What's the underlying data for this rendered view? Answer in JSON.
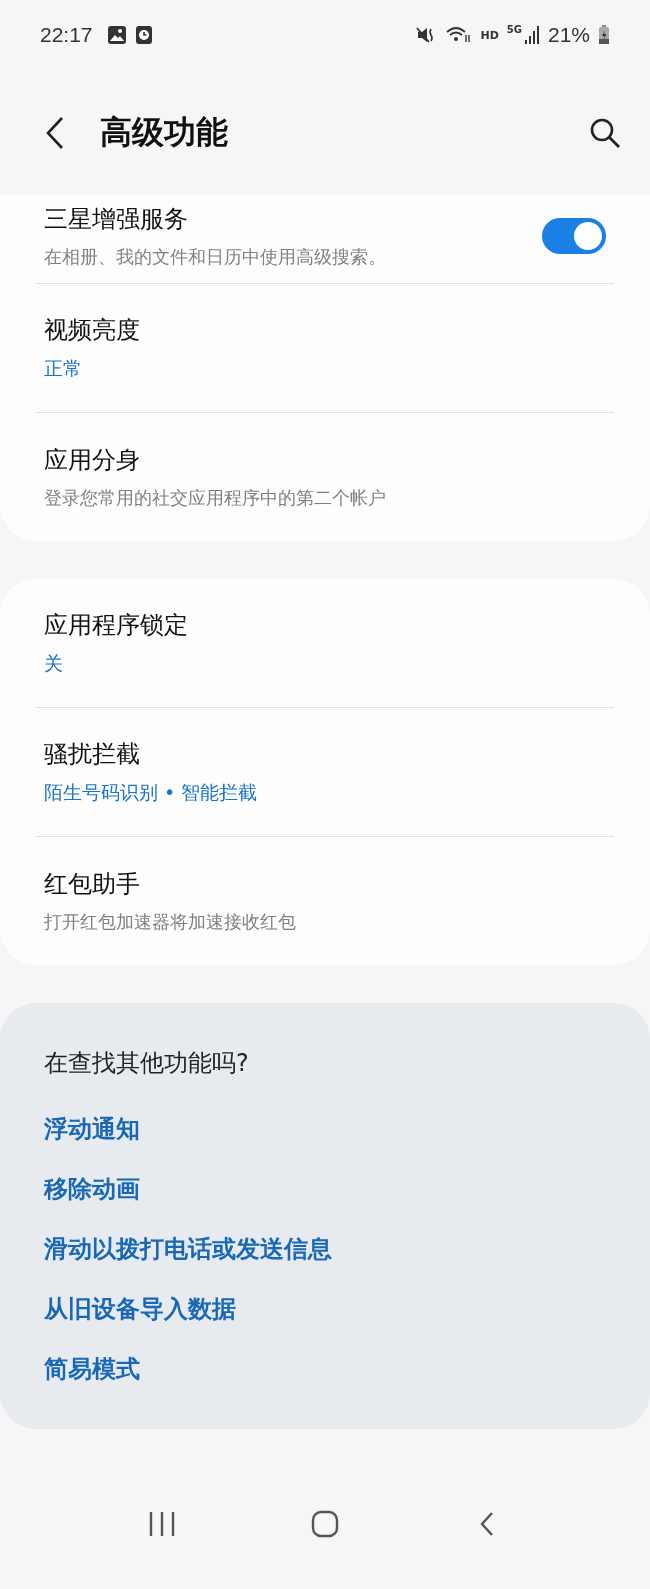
{
  "status_bar": {
    "time": "22:17",
    "network": "HD",
    "generation": "5G",
    "battery": "21%"
  },
  "header": {
    "title": "高级功能"
  },
  "groups": [
    {
      "items": [
        {
          "kind": "toggle",
          "title": "三星增强服务",
          "subtitle": "在相册、我的文件和日历中使用高级搜索。",
          "on": true
        },
        {
          "kind": "value",
          "title": "视频亮度",
          "subtitle": "正常"
        },
        {
          "kind": "plain",
          "title": "应用分身",
          "subtitle": "登录您常用的社交应用程序中的第二个帐户"
        }
      ]
    },
    {
      "items": [
        {
          "kind": "value",
          "title": "应用程序锁定",
          "subtitle": "关"
        },
        {
          "kind": "value",
          "title": "骚扰拦截",
          "subtitle": "陌生号码识别 • 智能拦截"
        },
        {
          "kind": "plain",
          "title": "红包助手",
          "subtitle": "打开红包加速器将加速接收红包"
        }
      ]
    }
  ],
  "suggestions": {
    "title": "在查找其他功能吗?",
    "links": [
      "浮动通知",
      "移除动画",
      "滑动以拨打电话或发送信息",
      "从旧设备导入数据",
      "简易模式"
    ]
  }
}
